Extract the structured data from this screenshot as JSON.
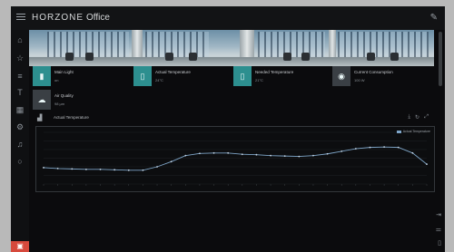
{
  "header": {
    "brand_main": "HORZONE",
    "brand_sub": "Office"
  },
  "sidebar": {
    "icons": [
      "home-icon",
      "star-icon",
      "list-icon",
      "thermometer-icon",
      "building-icon",
      "settings-icon",
      "bell-icon",
      "info-icon"
    ]
  },
  "tiles": [
    {
      "label": "Main Light",
      "value": "on",
      "icon": "light-icon",
      "glyph": "▮"
    },
    {
      "label": "Actual Temperature",
      "value": "24°C",
      "icon": "thermometer-icon",
      "glyph": "▯"
    },
    {
      "label": "Needed Temperature",
      "value": "21°C",
      "icon": "thermostat-icon",
      "glyph": "▯"
    },
    {
      "label": "Current Consumption",
      "value": "100 W",
      "icon": "power-icon",
      "glyph": "◉"
    },
    {
      "label": "Air Quality",
      "value": "98 µm",
      "icon": "cloud-icon",
      "glyph": "☁"
    }
  ],
  "chart_panel": {
    "title": "Actual Temperature"
  },
  "chart_data": {
    "type": "line",
    "title": "Actual Temperature",
    "legend": "right-top",
    "series": [
      {
        "name": "Actual Temperature",
        "color": "#7fa6c9",
        "values": [
          21.8,
          21.6,
          21.5,
          21.4,
          21.4,
          21.3,
          21.2,
          21.2,
          22.0,
          23.2,
          24.6,
          25.1,
          25.2,
          25.2,
          24.9,
          24.8,
          24.6,
          24.5,
          24.4,
          24.6,
          25.0,
          25.6,
          26.2,
          26.5,
          26.6,
          26.5,
          25.2,
          22.6
        ]
      }
    ],
    "ylim": [
      18,
      30
    ],
    "grid": true
  }
}
